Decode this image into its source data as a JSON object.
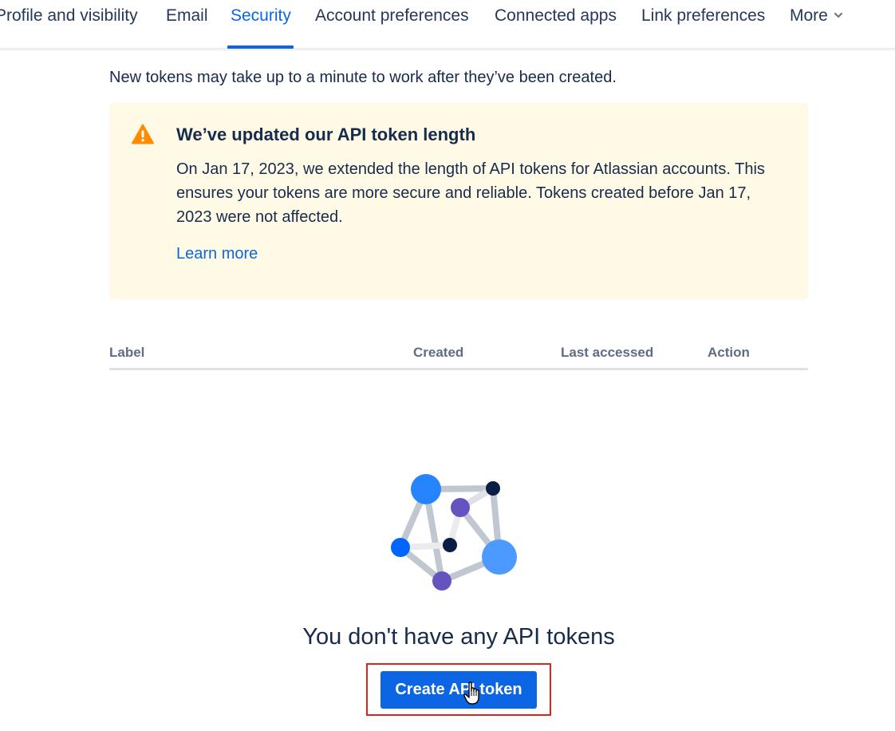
{
  "nav": {
    "tabs": [
      {
        "label": "Profile and visibility"
      },
      {
        "label": "Email"
      },
      {
        "label": "Security"
      },
      {
        "label": "Account preferences"
      },
      {
        "label": "Connected apps"
      },
      {
        "label": "Link preferences"
      },
      {
        "label": "More"
      }
    ],
    "active_tab": "Security"
  },
  "intro_text": "New tokens may take up to a minute to work after they’ve been created.",
  "banner": {
    "icon": "warning-icon",
    "title": "We’ve updated our API token length",
    "body": "On Jan 17, 2023, we extended the length of API tokens for Atlassian accounts. This ensures your tokens are more secure and reliable. Tokens created before Jan 17, 2023 were not affected.",
    "link": "Learn more"
  },
  "table": {
    "columns": [
      "Label",
      "Created",
      "Last accessed",
      "Action"
    ]
  },
  "empty_state": {
    "illustration": "network-graph-illustration",
    "title": "You don't have any API tokens",
    "button": "Create API token"
  },
  "colors": {
    "accent": "#0c66e4",
    "banner_bg": "#fffae6",
    "warning": "#ff8b00",
    "highlight_box": "#d9261c"
  }
}
